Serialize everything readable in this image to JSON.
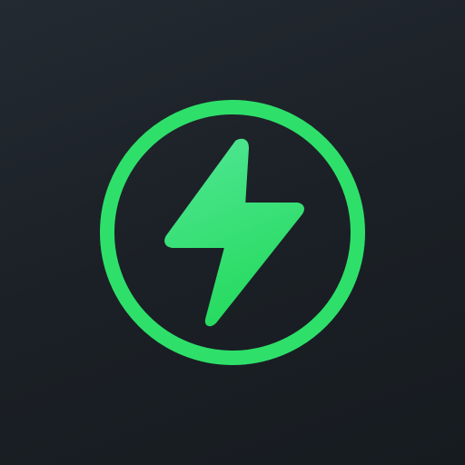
{
  "icon": {
    "name": "power-bolt-icon",
    "description_colors": {
      "background": "#1c2127",
      "ring": "#2ee06a",
      "bolt_top": "#4ee68f",
      "bolt_bottom": "#29dc62"
    }
  }
}
